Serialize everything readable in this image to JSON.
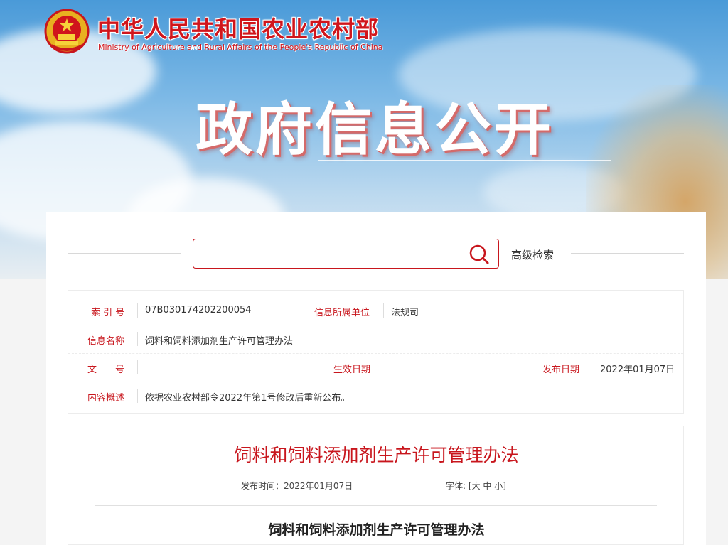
{
  "header": {
    "ministry_name_cn": "中华人民共和国农业农村部",
    "ministry_name_en": "Ministry of Agriculture and Rural Affairs of the People's Republic of China",
    "banner_title": "政府信息公开"
  },
  "search": {
    "placeholder": "",
    "advanced_label": "高级检索"
  },
  "info": {
    "index_label": "索 引 号",
    "index_value": "07B030174202200054",
    "unit_label": "信息所属单位",
    "unit_value": "法规司",
    "name_label": "信息名称",
    "name_value": "饲料和饲料添加剂生产许可管理办法",
    "doc_label": "文　　号",
    "doc_value": "",
    "effective_label": "生效日期",
    "effective_value": "",
    "publish_label": "发布日期",
    "publish_value": "2022年01月07日",
    "summary_label": "内容概述",
    "summary_value": "依据农业农村部令2022年第1号修改后重新公布。"
  },
  "article": {
    "title": "饲料和饲料添加剂生产许可管理办法",
    "publish_time_label": "发布时间：",
    "publish_time_value": "2022年01月07日",
    "font_label": "字体:",
    "font_open": "[",
    "font_large": "大",
    "font_medium": "中",
    "font_small": "小",
    "font_close": "]",
    "subtitle": "饲料和饲料添加剂生产许可管理办法"
  },
  "colors": {
    "accent": "#c8161d",
    "sky": "#4a9ad8"
  }
}
